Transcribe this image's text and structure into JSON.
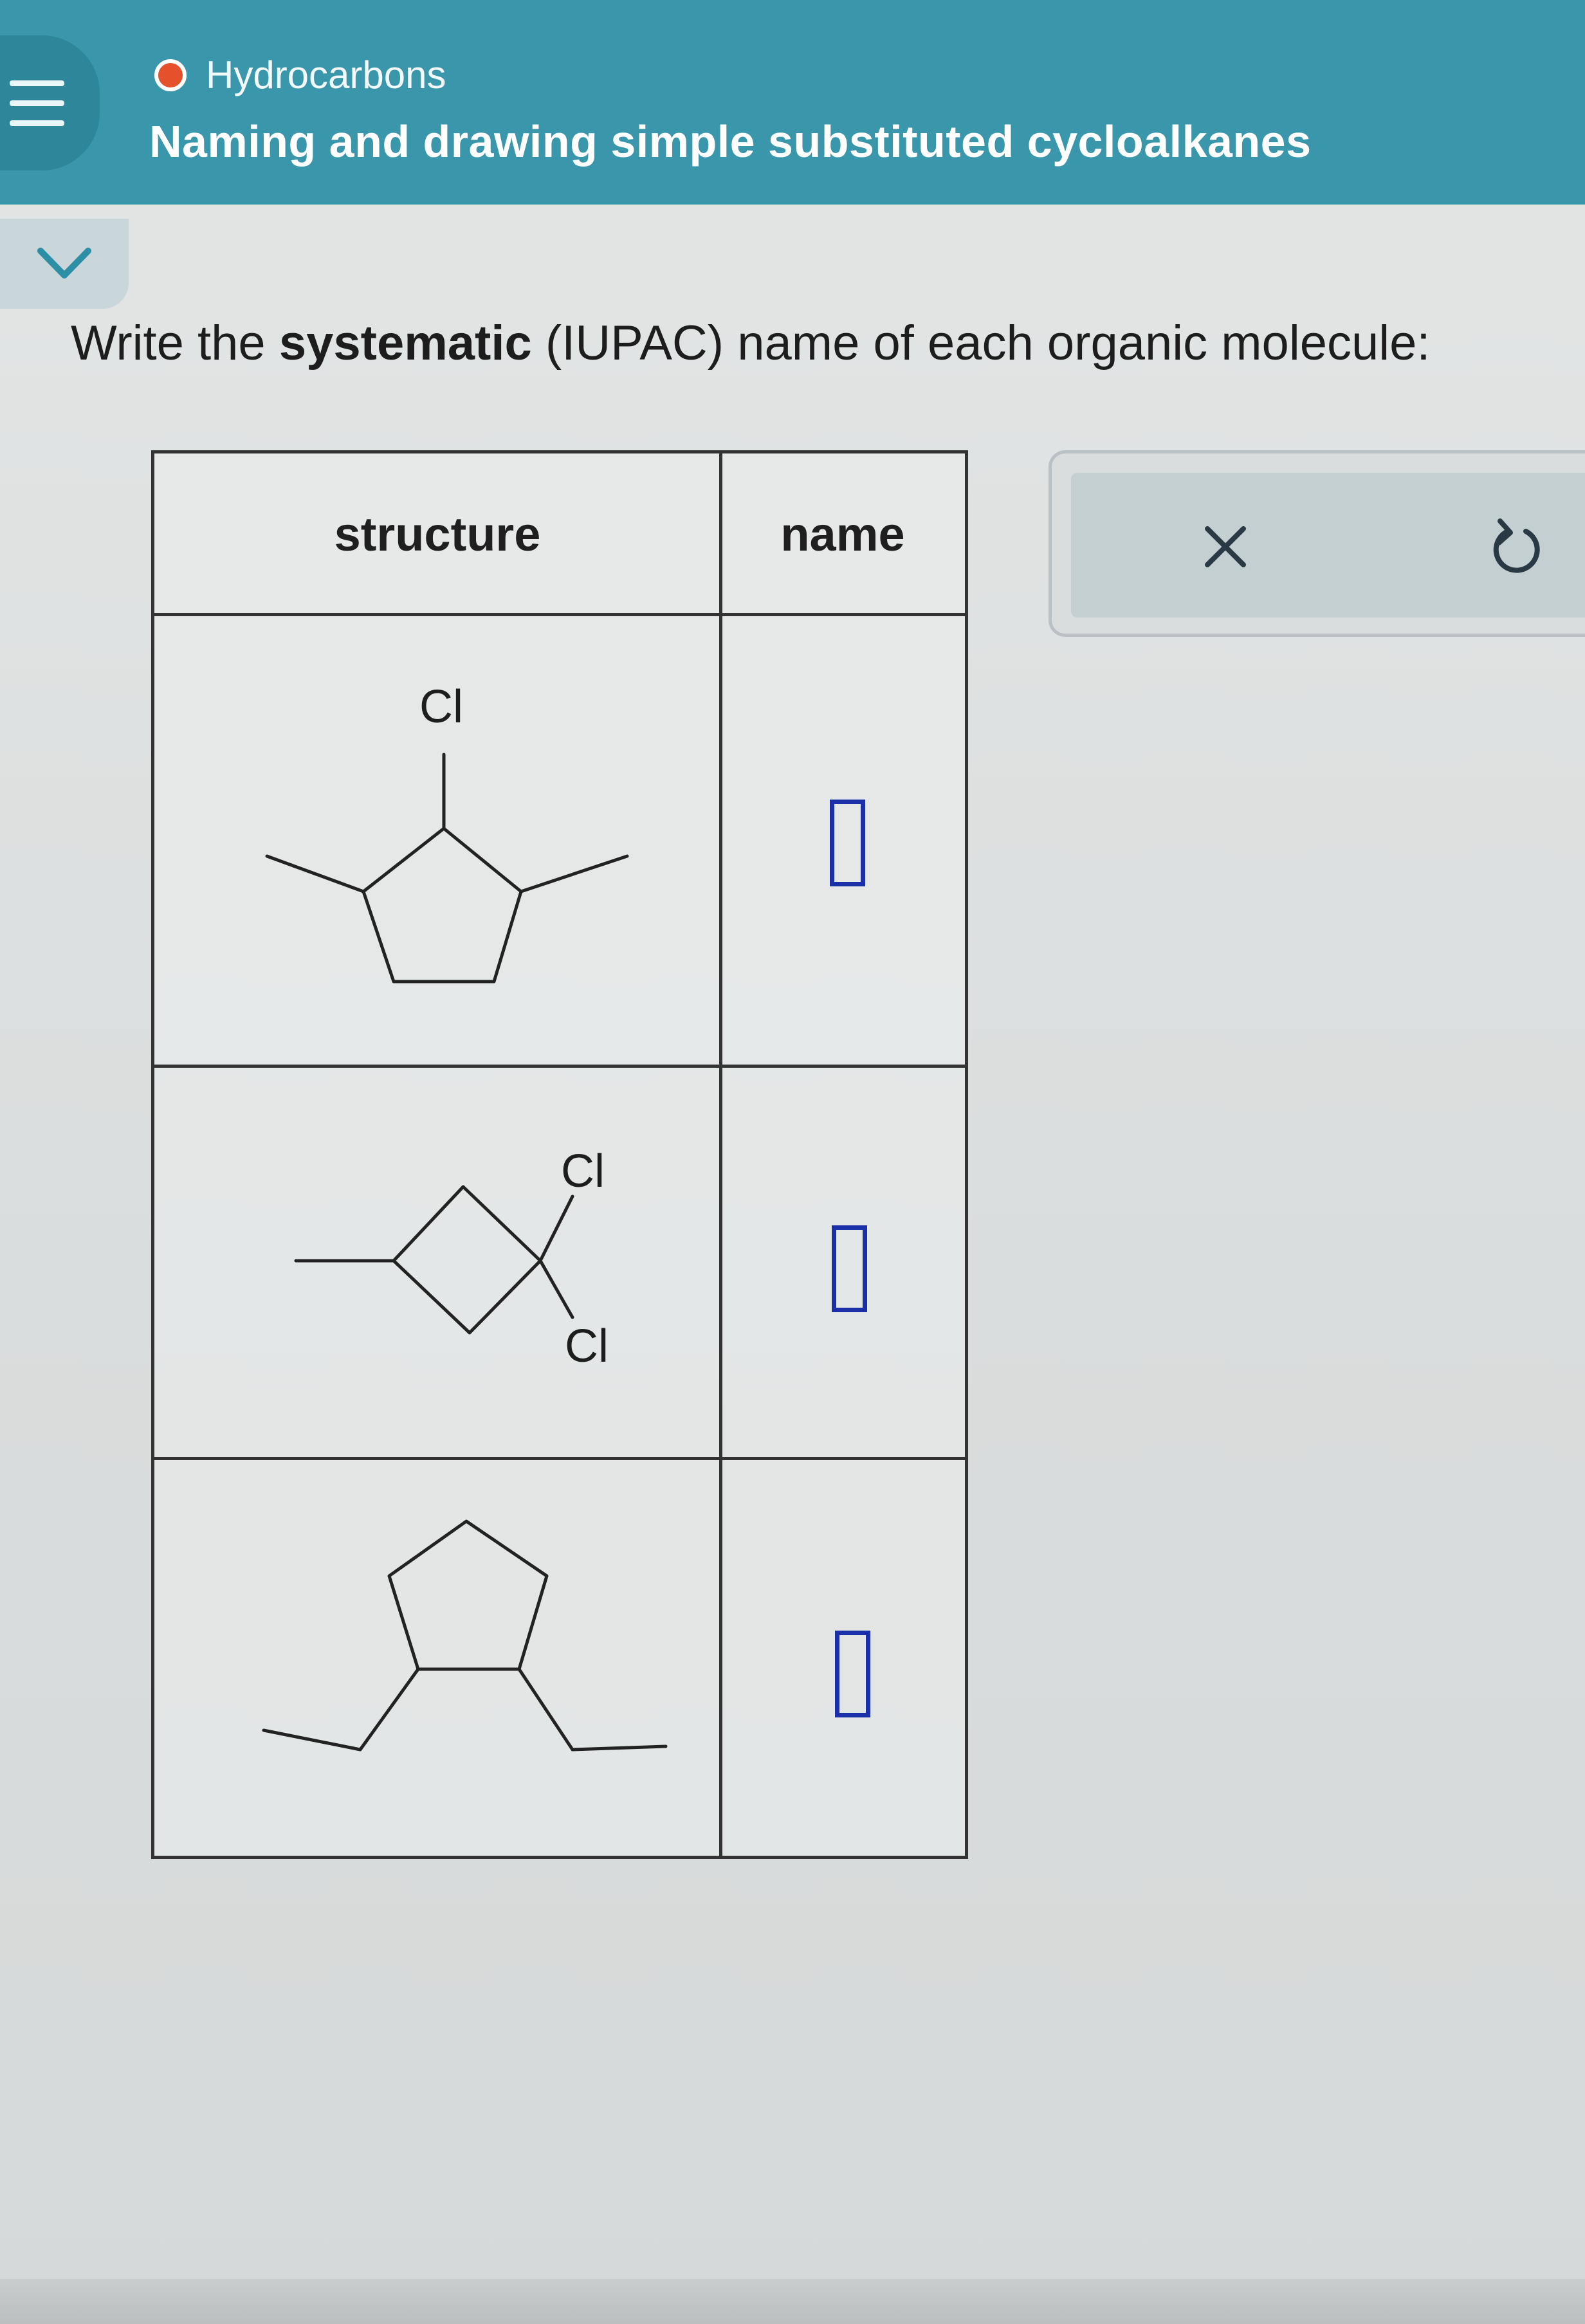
{
  "header": {
    "breadcrumb": "Hydrocarbons",
    "title": "Naming and drawing simple substituted cycloalkanes",
    "menu_icon": "hamburger-icon",
    "status_color": "#e3522b"
  },
  "collapse_icon": "chevron-down-icon",
  "instructions": {
    "prefix": "Write the ",
    "bold": "systematic",
    "suffix": " (IUPAC) name of each organic molecule:"
  },
  "table": {
    "columns": [
      "structure",
      "name"
    ],
    "rows": [
      {
        "atom_labels": [
          "Cl"
        ],
        "name_value": ""
      },
      {
        "atom_labels": [
          "Cl",
          "Cl"
        ],
        "name_value": ""
      },
      {
        "atom_labels": [],
        "name_value": ""
      }
    ]
  },
  "actions": {
    "clear_icon": "close-icon",
    "undo_icon": "undo-icon"
  },
  "colors": {
    "header_bg": "#3a97ab",
    "answer_slot_border": "#1b2fa8"
  }
}
